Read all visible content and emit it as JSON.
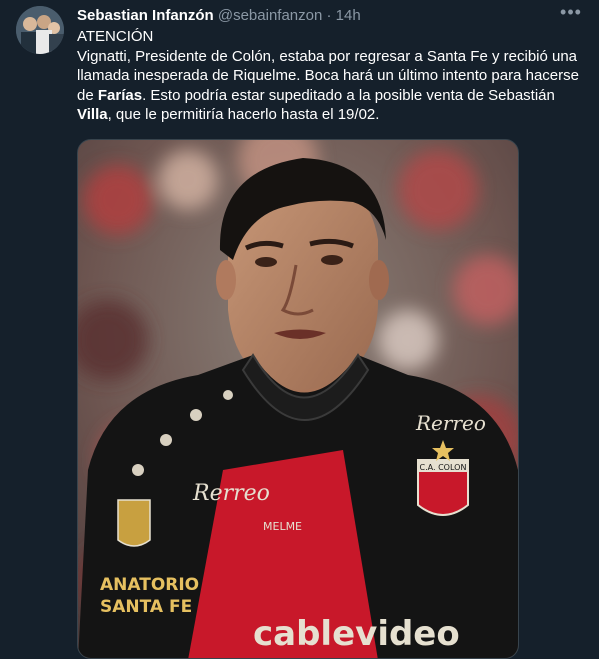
{
  "author": {
    "name": "Sebastian Infanzón",
    "handle": "@sebainfanzon",
    "separator": "·",
    "time": "14h"
  },
  "more_menu_icon": "ellipsis-icon",
  "tweet": {
    "line1": "ATENCIÓN",
    "p1": "Vignatti, Presidente de Colón, estaba por regresar a Santa Fe y recibió una llamada inesperada de Riquelme. Boca hará un último intento para hacerse de ",
    "bold1": "Farías",
    "p2": ". Esto podría estar supeditado a la posible venta de Sebastián ",
    "bold2": "Villa",
    "p3": ", que le permitiría hacerlo hasta el 19/02."
  },
  "photo": {
    "shirt_sponsor": "cablevideo",
    "chest_sponsor": "Rerreo",
    "shoulder_sponsor": "Rerreo",
    "crest_text": "C.A. COLON",
    "kit_brand": "MELME",
    "sleeve_text": [
      "ANATORIO",
      "SANTA FE"
    ]
  },
  "colors": {
    "background": "#15202b",
    "secondary_text": "#8b98a5",
    "jersey_red": "#c8182a",
    "jersey_black": "#141414"
  }
}
